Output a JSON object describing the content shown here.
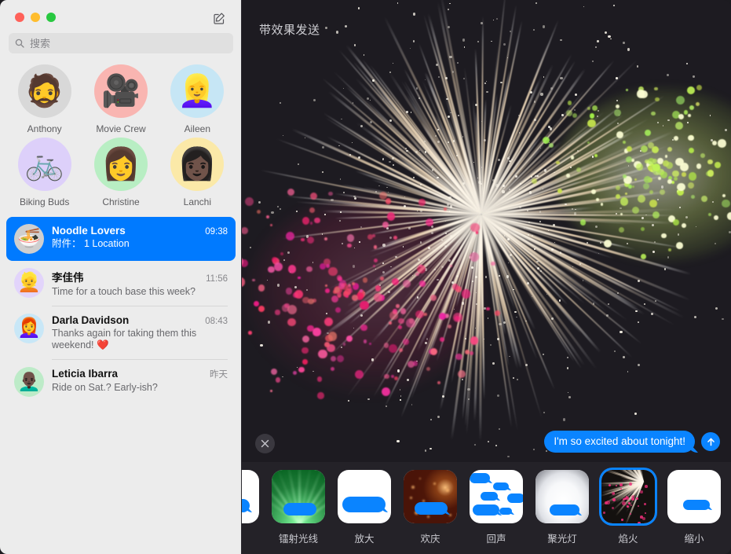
{
  "window": {
    "traffic_lights": [
      {
        "name": "close",
        "color": "#ff6159"
      },
      {
        "name": "minimize",
        "color": "#ffbd2e"
      },
      {
        "name": "zoom",
        "color": "#28c840"
      }
    ],
    "compose_icon": "compose-icon"
  },
  "search": {
    "placeholder": "搜索",
    "value": "",
    "icon": "search-icon"
  },
  "pinned": {
    "items": [
      {
        "label": "Anthony",
        "glyph": "🧔",
        "bg": "#d8d8d8"
      },
      {
        "label": "Movie Crew",
        "glyph": "🎥",
        "bg": "#f9b5b1"
      },
      {
        "label": "Aileen",
        "glyph": "👱‍♀️",
        "bg": "#c6e6f5"
      },
      {
        "label": "Biking Buds",
        "glyph": "🚲",
        "bg": "#ddd0fa"
      },
      {
        "label": "Christine",
        "glyph": "👩",
        "bg": "#b8eec3"
      },
      {
        "label": "Lanchi",
        "glyph": "👩🏿",
        "bg": "#fbe9a8"
      }
    ]
  },
  "conversations": {
    "items": [
      {
        "name": "Noodle Lovers",
        "time": "09:38",
        "preview": "附件： 1 Location",
        "glyph": "🍜",
        "bg": "#cfcfcf",
        "selected": true
      },
      {
        "name": "李佳伟",
        "time": "11:56",
        "preview": "Time for a touch base this week?",
        "glyph": "👱",
        "bg": "#e2d4fb",
        "selected": false
      },
      {
        "name": "Darla Davidson",
        "time": "08:43",
        "preview": "Thanks again for taking them this weekend! ❤️",
        "glyph": "👩‍🦰",
        "bg": "#c8e7f7",
        "selected": false
      },
      {
        "name": "Leticia Ibarra",
        "time": "昨天",
        "preview": "Ride on Sat.? Early-ish?",
        "glyph": "👨🏿‍🦲",
        "bg": "#bdebc8",
        "selected": false
      }
    ]
  },
  "effect_screen": {
    "title": "带效果发送",
    "active_effect": "焰火",
    "dismiss_icon": "close-icon",
    "send_icon": "send-arrow-up-icon",
    "message": {
      "text": "I'm so excited about tonight!",
      "bubble_color": "#0a84ff",
      "text_color": "#ffffff"
    },
    "firework": {
      "ray_color": "#fff6e6",
      "accent_green": "#c2e356",
      "accent_pink": "#f0307a",
      "background": "#1d1b21"
    }
  },
  "effects_bar": {
    "background": "#242228",
    "items": [
      {
        "label": "",
        "art": "clipped-bubble",
        "selected": false
      },
      {
        "label": "镭射光线",
        "art": "laser",
        "selected": false
      },
      {
        "label": "放大",
        "art": "big",
        "selected": false
      },
      {
        "label": "欢庆",
        "art": "celebration",
        "selected": false
      },
      {
        "label": "回声",
        "art": "echo",
        "selected": false
      },
      {
        "label": "聚光灯",
        "art": "spotlight",
        "selected": false
      },
      {
        "label": "焰火",
        "art": "fireworks",
        "selected": true
      },
      {
        "label": "缩小",
        "art": "small",
        "selected": false
      }
    ]
  }
}
